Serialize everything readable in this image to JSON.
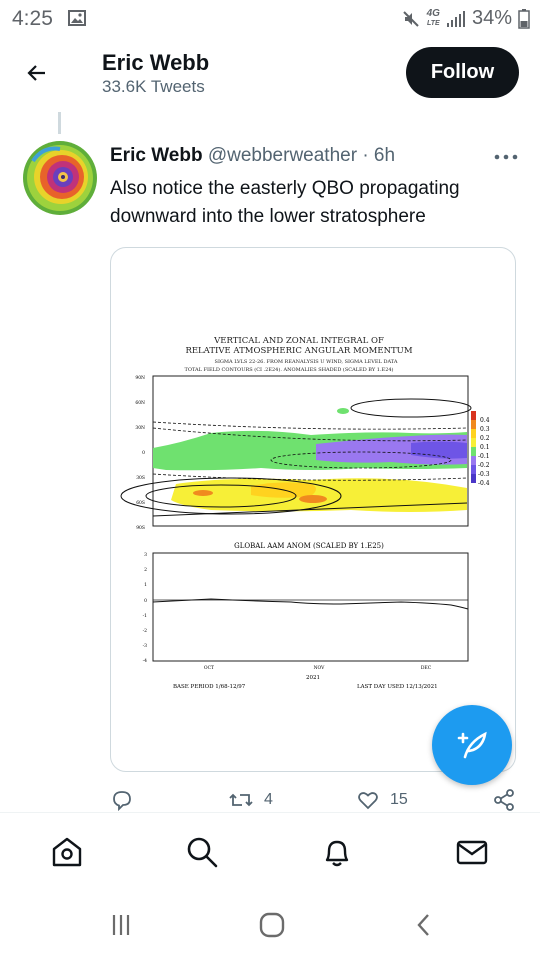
{
  "status_bar": {
    "time": "4:25",
    "network": "4G",
    "network_sub": "LTE",
    "battery": "34%",
    "icons": [
      "gallery-icon",
      "mute-icon",
      "signal-icon"
    ]
  },
  "header": {
    "name": "Eric Webb",
    "tweet_count": "33.6K Tweets",
    "follow_label": "Follow"
  },
  "tweet": {
    "author_name": "Eric Webb",
    "handle_time": "@webberweather · 6h",
    "text": "Also notice the easterly QBO propagating downward into the lower stratosphere",
    "retweets": "4",
    "likes": "15"
  },
  "figure": {
    "title_line1": "VERTICAL AND ZONAL INTEGRAL OF",
    "title_line2": "RELATIVE ATMOSPHERIC ANGULAR MOMENTUM",
    "subtitle1": "SIGMA LVLS 22-26. FROM REANALYSIS U WIND, SIGMA LEVEL DATA",
    "subtitle2": "TOTAL FIELD CONTOURS (CI .2E24). ANOMALIES SHADED (SCALED BY 1.E24)",
    "lat_ticks": [
      "90N",
      "60N",
      "30N",
      "0",
      "30S",
      "60S",
      "90S"
    ],
    "colorbar": [
      "0.4",
      "0.3",
      "0.2",
      "0.1",
      "-0.1",
      "-0.2",
      "-0.3",
      "-0.4"
    ],
    "lower_title": "GLOBAL AAM ANOM (SCALED BY 1.E25)",
    "y_ticks": [
      "3",
      "2",
      "1",
      "0",
      "-1",
      "-2",
      "-3",
      "-4"
    ],
    "months": [
      "OCT",
      "NOV",
      "DEC"
    ],
    "year": "2021",
    "base_period": "BASE PERIOD  1/68-12/97",
    "last_day": "LAST DAY USED 12/13/2021"
  },
  "colors": {
    "accent": "#1d9bf0",
    "text": "#0f1419",
    "muted": "#536471"
  }
}
